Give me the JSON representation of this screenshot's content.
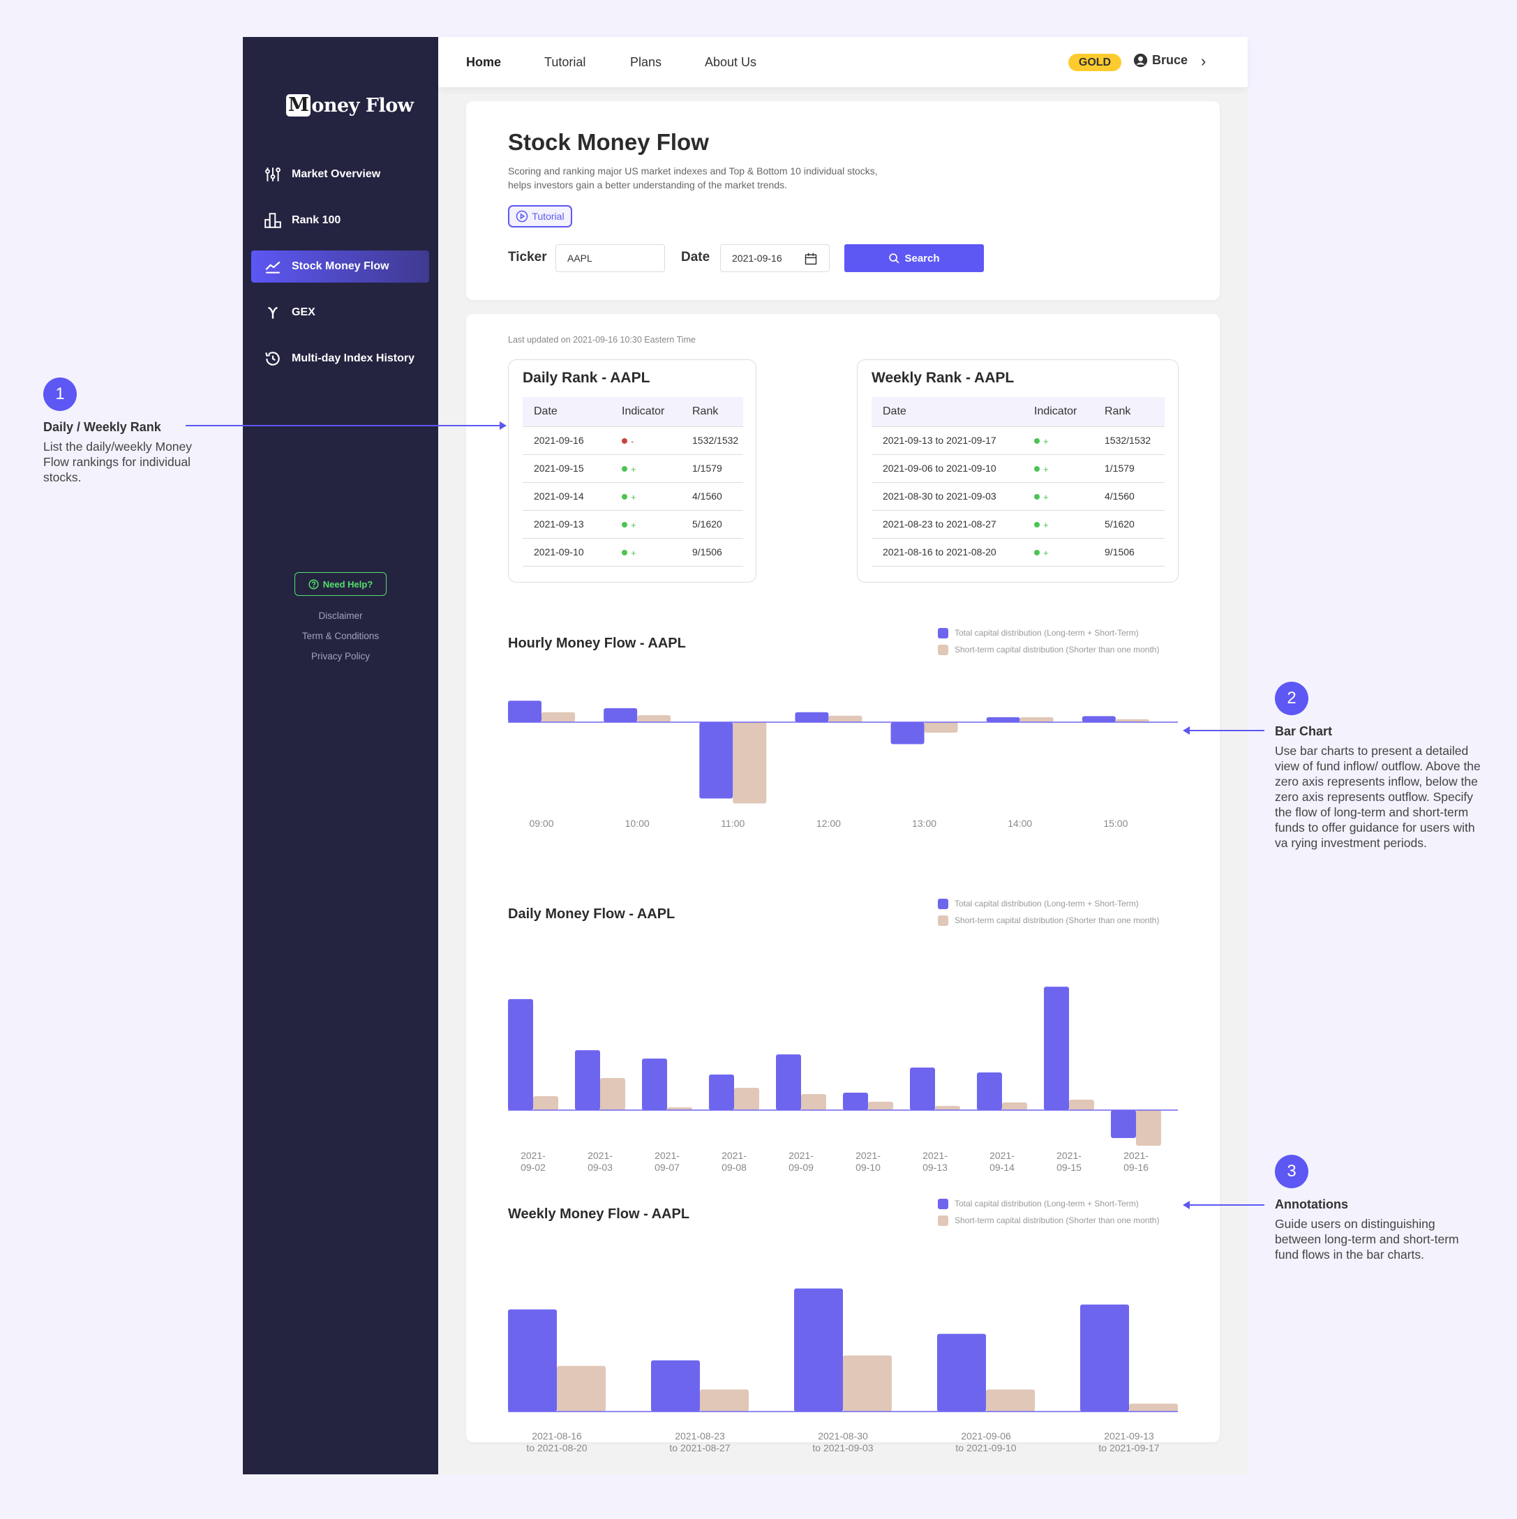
{
  "app": {
    "logo_initial": "M",
    "logo_rest": "oney Flow"
  },
  "sidebar": {
    "items": [
      {
        "label": "Market Overview",
        "icon": "sliders-icon"
      },
      {
        "label": "Rank 100",
        "icon": "bar-chart-icon"
      },
      {
        "label": "Stock Money Flow",
        "icon": "trend-line-icon",
        "active": true
      },
      {
        "label": "GEX",
        "icon": "gamma-icon"
      },
      {
        "label": "Multi-day Index History",
        "icon": "history-icon"
      }
    ],
    "help_label": "Need Help?",
    "footer_links": [
      "Disclaimer",
      "Term & Conditions",
      "Privacy Policy"
    ]
  },
  "topbar": {
    "nav": [
      "Home",
      "Tutorial",
      "Plans",
      "About Us"
    ],
    "active": "Home",
    "badge": "GOLD",
    "user_name": "Bruce"
  },
  "header": {
    "title": "Stock Money Flow",
    "description": "Scoring and ranking major US market indexes and Top & Bottom 10 individual stocks, helps investors gain a better understanding of the market trends.",
    "tutorial_label": "Tutorial",
    "ticker_label": "Ticker",
    "ticker_value": "AAPL",
    "date_label": "Date",
    "date_value": "2021-09-16",
    "search_label": "Search"
  },
  "content": {
    "last_updated": "Last updated on 2021-09-16 10:30 Eastern Time",
    "daily_rank": {
      "title": "Daily Rank - AAPL",
      "columns": [
        "Date",
        "Indicator",
        "Rank"
      ],
      "rows": [
        {
          "date": "2021-09-16",
          "indicator": "-",
          "rank": "1532/1532"
        },
        {
          "date": "2021-09-15",
          "indicator": "+",
          "rank": "1/1579"
        },
        {
          "date": "2021-09-14",
          "indicator": "+",
          "rank": "4/1560"
        },
        {
          "date": "2021-09-13",
          "indicator": "+",
          "rank": "5/1620"
        },
        {
          "date": "2021-09-10",
          "indicator": "+",
          "rank": "9/1506"
        }
      ]
    },
    "weekly_rank": {
      "title": "Weekly Rank - AAPL",
      "columns": [
        "Date",
        "Indicator",
        "Rank"
      ],
      "rows": [
        {
          "date": "2021-09-13 to 2021-09-17",
          "indicator": "+",
          "rank": "1532/1532"
        },
        {
          "date": "2021-09-06 to 2021-09-10",
          "indicator": "+",
          "rank": "1/1579"
        },
        {
          "date": "2021-08-30 to 2021-09-03",
          "indicator": "+",
          "rank": "4/1560"
        },
        {
          "date": "2021-08-23 to 2021-08-27",
          "indicator": "+",
          "rank": "5/1620"
        },
        {
          "date": "2021-08-16 to 2021-08-20",
          "indicator": "+",
          "rank": "9/1506"
        }
      ]
    },
    "indicator_colors": {
      "+": "#4cc450",
      "-": "#c9463d"
    }
  },
  "legend": {
    "total": "Total capital distribution  (Long-term + Short-Term)",
    "short": "Short-term capital distribution (Shorter than one month)"
  },
  "colors": {
    "total": "#6e65ef",
    "short": "#e0c7b7",
    "accent": "#5d57f4"
  },
  "chart_data": [
    {
      "type": "bar",
      "title": "Hourly Money Flow - AAPL",
      "categories": [
        "09:00",
        "10:00",
        "11:00",
        "12:00",
        "13:00",
        "14:00",
        "15:00"
      ],
      "series": [
        {
          "name": "Total capital distribution  (Long-term + Short-Term)",
          "values": [
            43,
            28,
            -153,
            20,
            -44,
            10,
            12
          ]
        },
        {
          "name": "Short-term capital distribution (Shorter than one month)",
          "values": [
            20,
            14,
            -163,
            13,
            -21,
            10,
            6
          ]
        }
      ],
      "xlabel": "",
      "ylabel": "",
      "ylim": [
        -170,
        50
      ],
      "grid": false,
      "legend": "top-right",
      "units": "relative (unlabeled axis)"
    },
    {
      "type": "bar",
      "title": "Daily Money Flow - AAPL",
      "categories": [
        "2021-\n09-02",
        "2021-\n09-03",
        "2021-\n09-07",
        "2021-\n09-08",
        "2021-\n09-09",
        "2021-\n09-10",
        "2021-\n09-13",
        "2021-\n09-14",
        "2021-\n09-15",
        "2021-\n09-16"
      ],
      "series": [
        {
          "name": "Total capital distribution  (Long-term + Short-Term)",
          "values": [
            478,
            258,
            222,
            153,
            240,
            75,
            183,
            162,
            531,
            -120
          ]
        },
        {
          "name": "Short-term capital distribution (Shorter than one month)",
          "values": [
            60,
            138,
            12,
            96,
            69,
            36,
            18,
            33,
            45,
            -153
          ]
        }
      ],
      "xlabel": "",
      "ylabel": "",
      "ylim": [
        -160,
        540
      ],
      "grid": false,
      "legend": "top-right",
      "units": "relative (unlabeled axis)"
    },
    {
      "type": "bar",
      "title": "Weekly Money Flow - AAPL",
      "categories": [
        "2021-08-16\nto 2021-08-20",
        "2021-08-23\nto 2021-08-27",
        "2021-08-30\nto 2021-09-03",
        "2021-09-06\nto 2021-09-10",
        "2021-09-13\nto 2021-09-17"
      ],
      "series": [
        {
          "name": "Total capital distribution  (Long-term + Short-Term)",
          "values": [
            439,
            220,
            529,
            334,
            460
          ]
        },
        {
          "name": "Short-term capital distribution (Shorter than one month)",
          "values": [
            196,
            95,
            241,
            95,
            34
          ]
        }
      ],
      "xlabel": "",
      "ylabel": "",
      "ylim": [
        0,
        540
      ],
      "grid": false,
      "legend": "top-right",
      "units": "relative (unlabeled axis)"
    }
  ],
  "annotations": [
    {
      "number": "1",
      "title": "Daily / Weekly Rank",
      "text": "List the daily/weekly Money Flow rankings for individual stocks."
    },
    {
      "number": "2",
      "title": "Bar Chart",
      "text": "Use bar charts to present a detailed view of fund inflow/ outflow. Above the zero axis represents inflow, below the zero axis represents outflow. Specify the flow of long-term and short-term funds to offer guidance for users with va rying investment periods."
    },
    {
      "number": "3",
      "title": "Annotations",
      "text": "Guide users on distinguishing between long-term and short-term fund flows in the bar charts."
    }
  ]
}
